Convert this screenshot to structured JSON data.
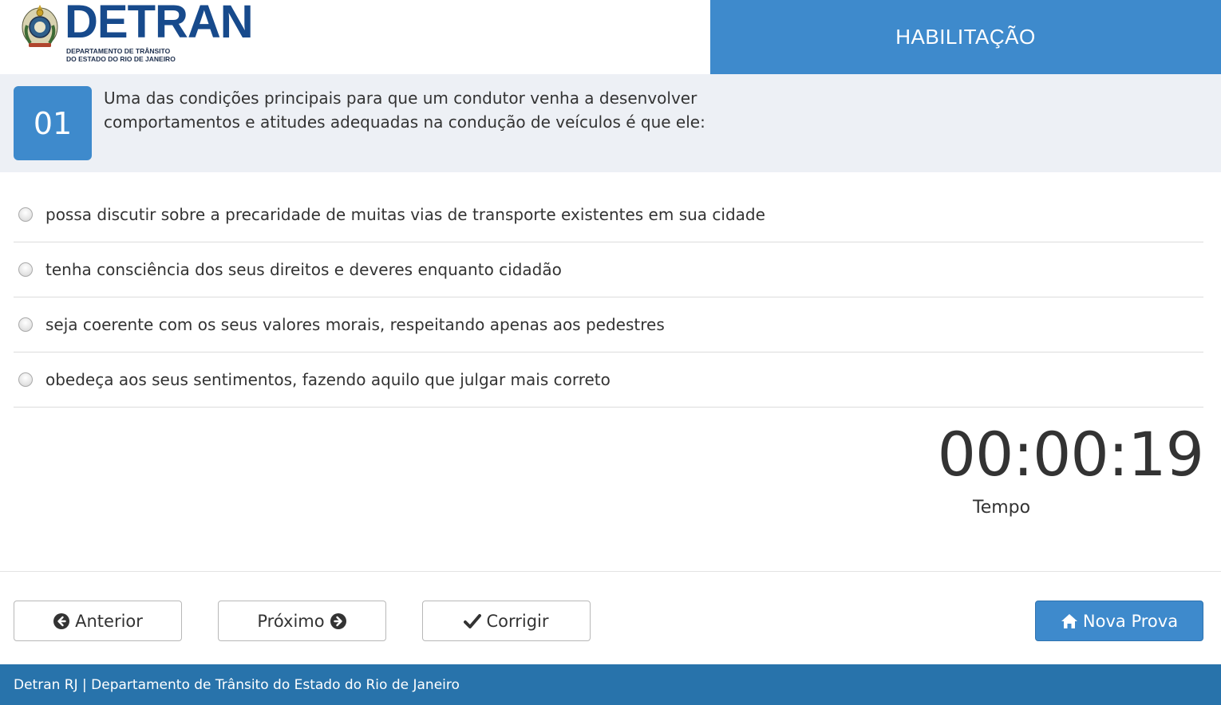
{
  "header": {
    "logo": {
      "name": "DETRAN",
      "subtitle": "DEPARTAMENTO DE TRÂNSITO\nDO ESTADO DO RIO DE JANEIRO"
    },
    "section_title": "HABILITAÇÃO"
  },
  "question": {
    "number": "01",
    "text": "Uma das condições principais para que um condutor venha a desenvolver comportamentos e atitudes adequadas na condução de veículos é que ele:"
  },
  "options": [
    {
      "text": "possa discutir sobre a precaridade de muitas vias de transporte existentes em sua cidade"
    },
    {
      "text": "tenha consciência dos seus direitos e deveres enquanto cidadão"
    },
    {
      "text": "seja coerente com os seus valores morais, respeitando apenas aos pedestres"
    },
    {
      "text": "obedeça aos seus sentimentos, fazendo aquilo que julgar mais correto"
    }
  ],
  "timer": {
    "value": "00:00:19",
    "label": "Tempo"
  },
  "buttons": {
    "previous": {
      "label": "Anterior",
      "icon": "arrow-circle-left-icon"
    },
    "next": {
      "label": "Próximo",
      "icon": "arrow-circle-right-icon"
    },
    "check": {
      "label": "Corrigir",
      "icon": "check-icon"
    },
    "new_exam": {
      "label": "Nova Prova",
      "icon": "home-icon"
    }
  },
  "footer": {
    "text": "Detran RJ | Departamento de Trânsito do Estado do Rio de Janeiro"
  },
  "colors": {
    "accent": "#3e8acc",
    "footer": "#2873ab",
    "question_band": "#edf0f5",
    "logo": "#174a8c"
  }
}
